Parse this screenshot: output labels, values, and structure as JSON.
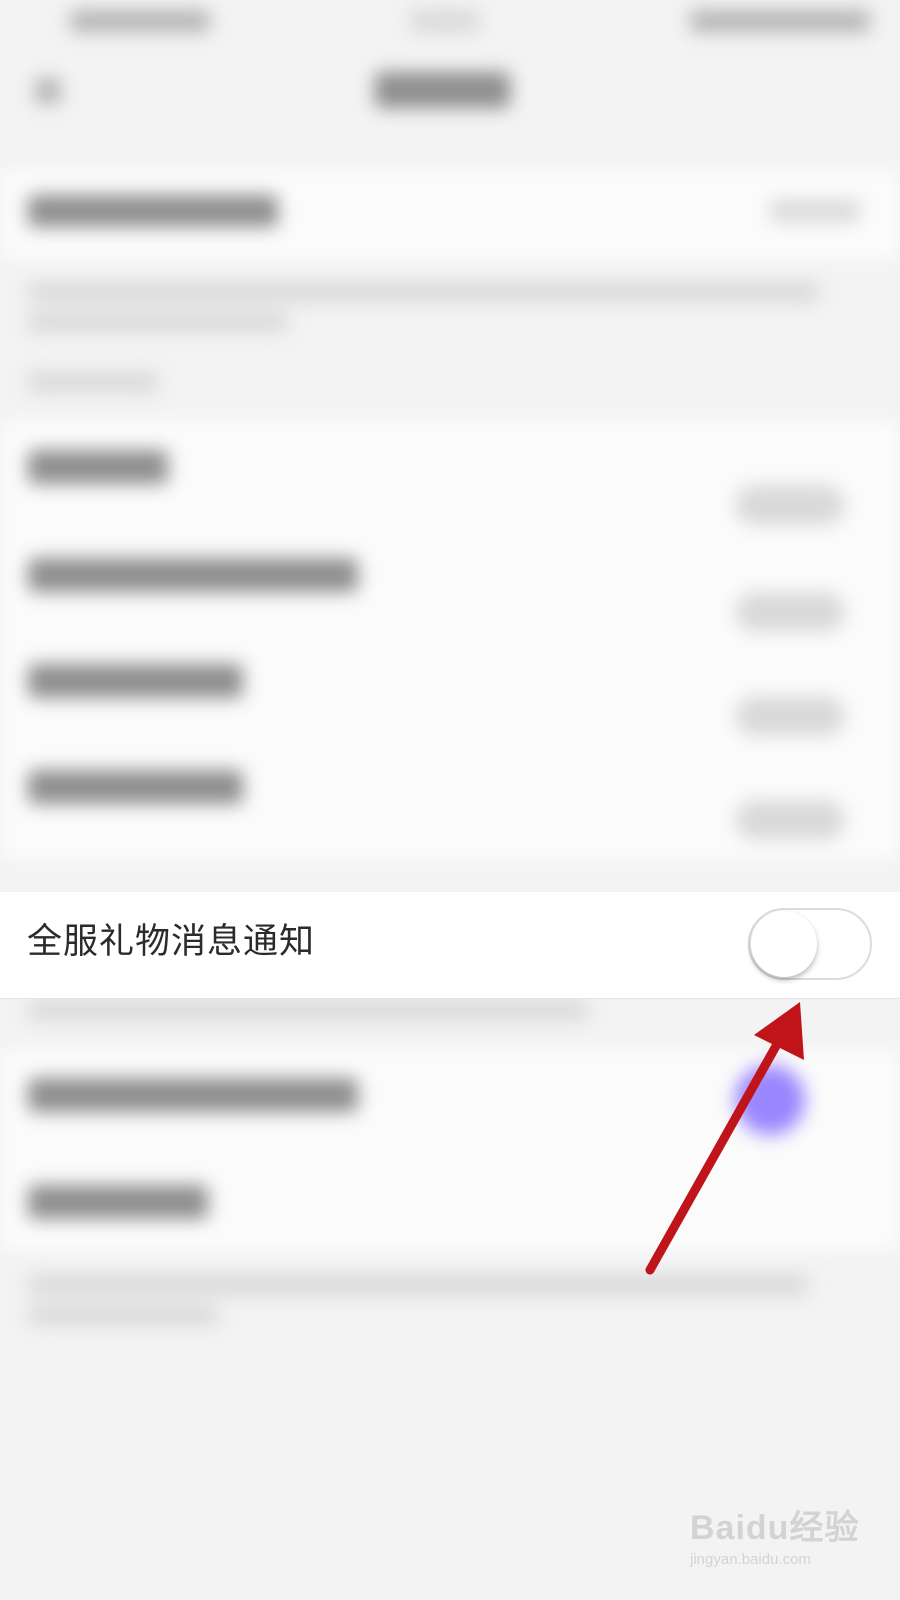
{
  "settings_row": {
    "label": "全服礼物消息通知",
    "toggle_on": false
  },
  "watermark": {
    "logo": "Baidu经验",
    "url": "jingyan.baidu.com"
  },
  "colors": {
    "arrow": "#c0141b",
    "toggle_border": "#dcdcdc",
    "background": "#f3f3f3"
  }
}
